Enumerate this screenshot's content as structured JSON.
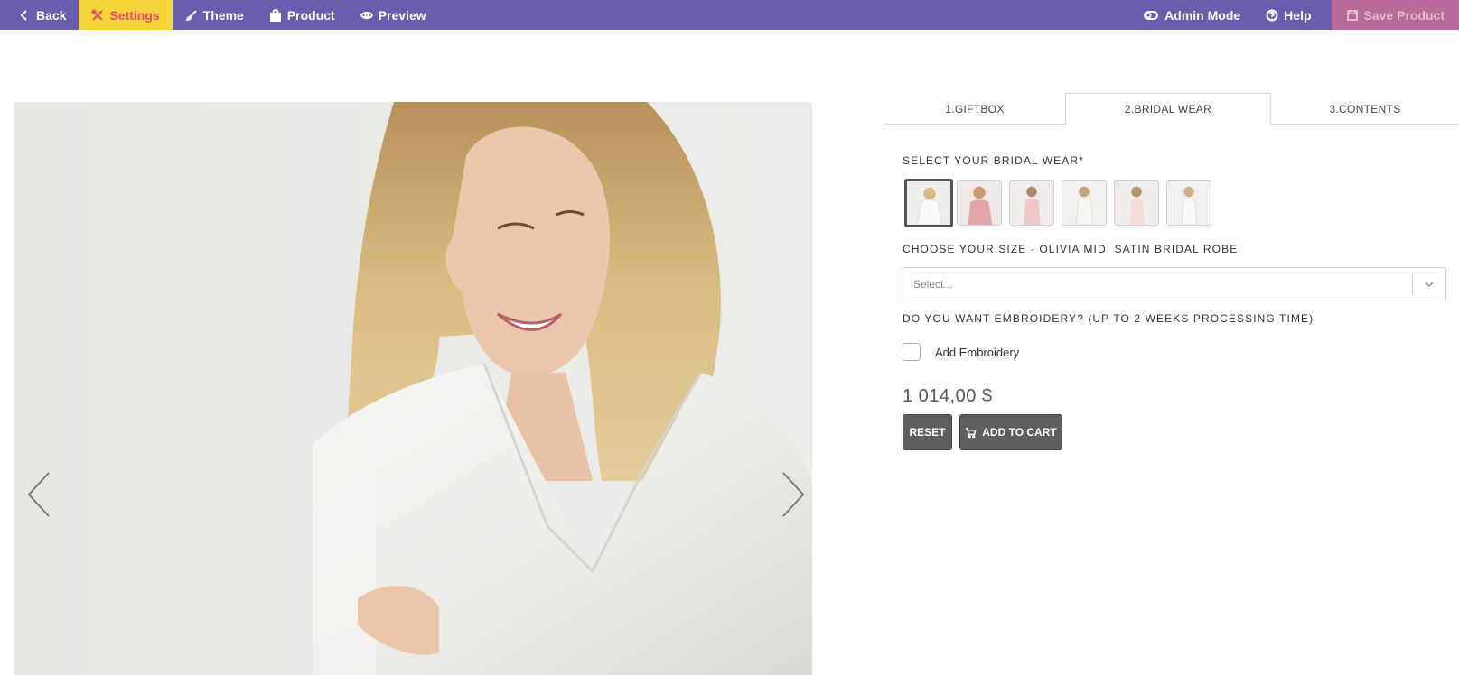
{
  "topbar": {
    "back": "Back",
    "settings": "Settings",
    "theme": "Theme",
    "product": "Product",
    "preview": "Preview",
    "admin_mode": "Admin Mode",
    "help": "Help",
    "save_product": "Save Product"
  },
  "tabs": [
    "1.GIFTBOX",
    "2.BRIDAL WEAR",
    "3.CONTENTS"
  ],
  "form": {
    "bridal_label": "SELECT YOUR BRIDAL WEAR*",
    "size_label": "CHOOSE YOUR SIZE - OLIVIA MIDI SATIN BRIDAL ROBE",
    "size_placeholder": "Select...",
    "embroidery_label": "DO YOU WANT EMBROIDERY? (UP TO 2 WEEKS PROCESSING TIME)",
    "embroidery_option": "Add Embroidery",
    "price": "1 014,00 $",
    "reset": "RESET",
    "add_to_cart": "ADD TO CART"
  },
  "colors": {
    "topbar": "#6c5cb0",
    "active_tab_bg": "#f5d53a",
    "active_tab_text": "#e84e6a",
    "button": "#5e5e5e"
  }
}
